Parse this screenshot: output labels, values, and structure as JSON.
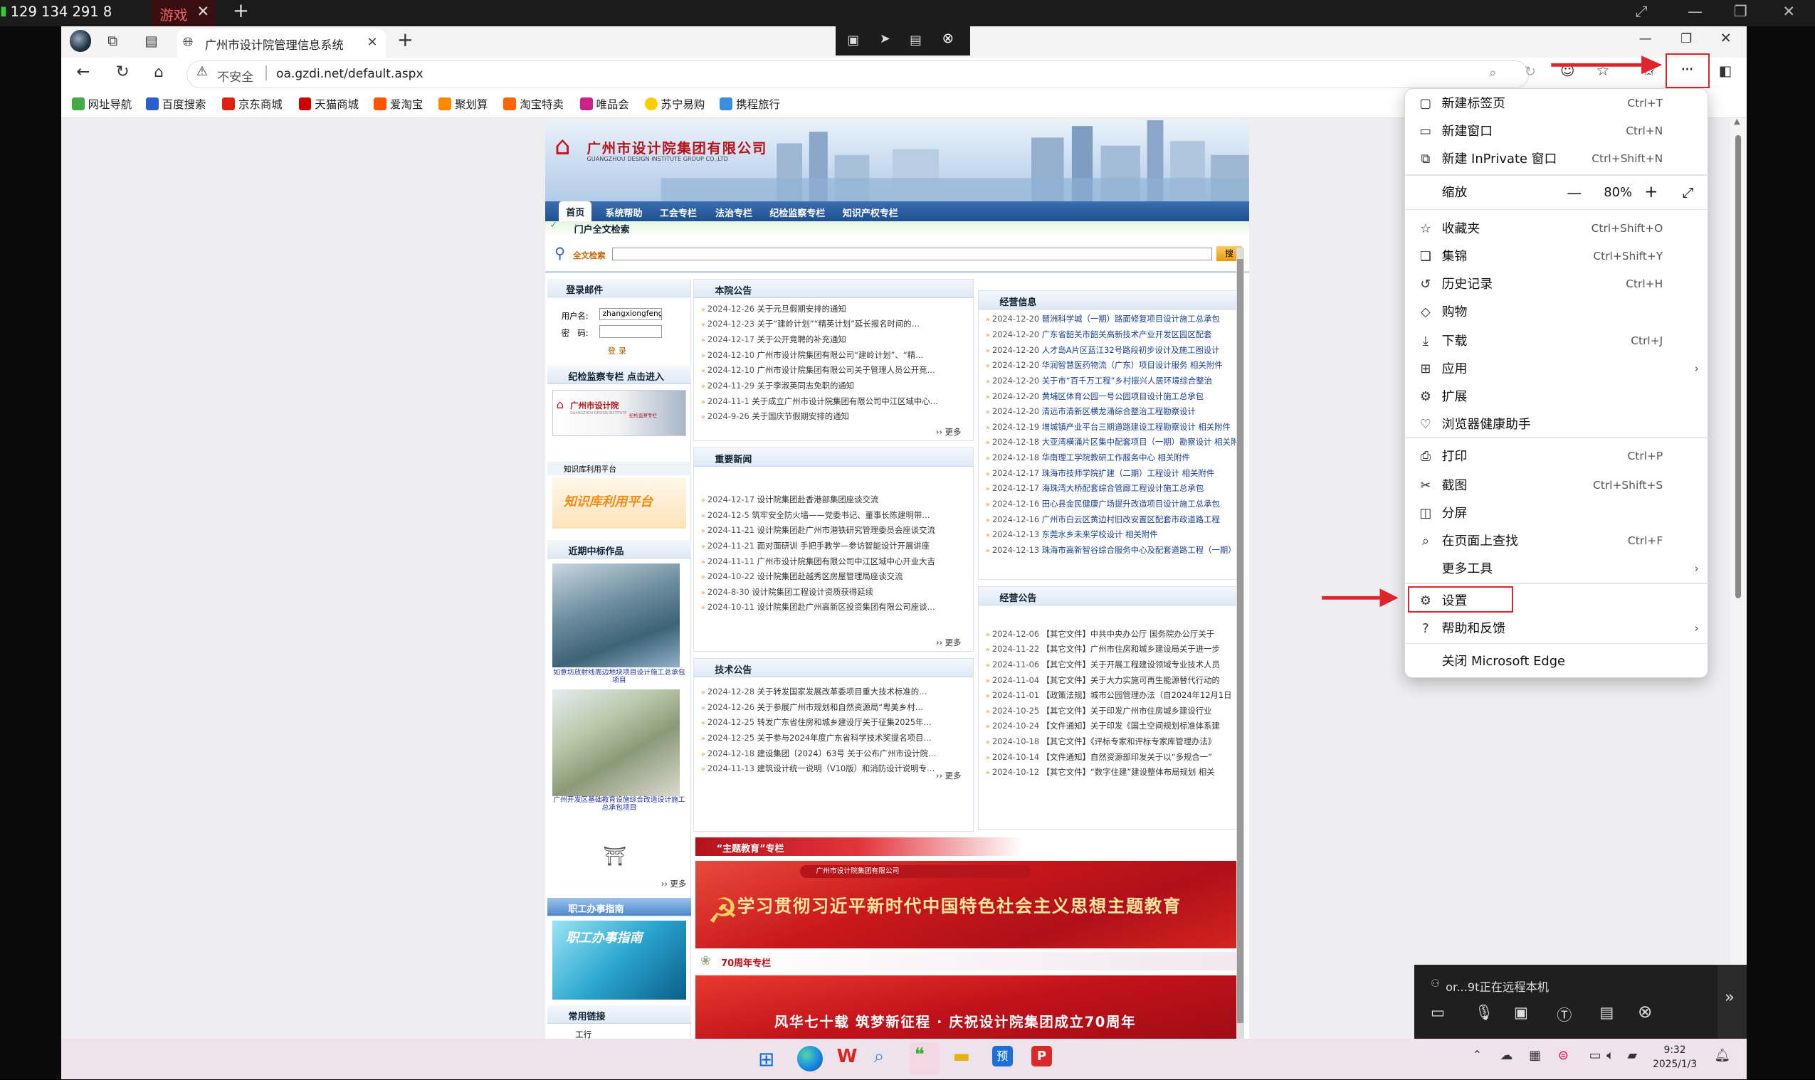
{
  "remote_bar": {
    "id": "129 134 291 8",
    "tab": "游戏"
  },
  "browser": {
    "tab_title": "广州市设计院管理信息系统",
    "insecure": "不安全",
    "url": "oa.gzdi.net/default.aspx",
    "favorites": [
      "网址导航",
      "百度搜索",
      "京东商城",
      "天猫商城",
      "爱淘宝",
      "聚划算",
      "淘宝特卖",
      "唯品会",
      "苏宁易购",
      "携程旅行"
    ]
  },
  "site": {
    "company": "广州市设计院集团有限公司",
    "company_en": "GUANGZHOU DESIGN INSTITUTE GROUP CO.,LTD",
    "nav": [
      "首页",
      "系统帮助",
      "工会专栏",
      "法治专栏",
      "纪检监察专栏",
      "知识产权专栏"
    ],
    "portal": "门户全文检索",
    "search_label": "全文检索",
    "search_btn": "搜",
    "login": {
      "title": "登录邮件",
      "user_label": "用户名:",
      "user_value": "zhangxiongfeng",
      "pwd_label": "密　码:",
      "btn": "登 录"
    },
    "jijian": "纪检监察专栏 点击进入",
    "jijian_banner": "广州市设计院",
    "jijian_banner_en": "GUANGZHOU DESIGN INSTITUTE",
    "jijian_banner_sub": "纪检监察专栏",
    "knowledge": "知识库利用平台",
    "knowledge_banner": "知识库利用平台",
    "bids": "近期中标作品",
    "bid1": "如意坊放射线周边地块项目设计施工总承包项目",
    "bid2": "广州开发区基础教育设施综合改造设计施工总承包项目",
    "staff": "职工办事指南",
    "staff_banner": "职工办事指南",
    "links": "常用链接",
    "links_item": "工行",
    "more": "›› 更多",
    "notice": {
      "title": "本院公告",
      "items": [
        [
          "2024-12-26",
          "关于元旦假期安排的通知"
        ],
        [
          "2024-12-23",
          "关于“建岭计划”“精英计划”延长报名时间的…"
        ],
        [
          "2024-12-17",
          "关于公开竞聘的补充通知"
        ],
        [
          "2024-12-10",
          "广州市设计院集团有限公司“建岭计划”、“精…"
        ],
        [
          "2024-12-10",
          "广州市设计院集团有限公司关于管理人员公开竞…"
        ],
        [
          "2024-11-29",
          "关于李淑英同志免职的通知"
        ],
        [
          "2024-11-1",
          "关于成立广州市设计院集团有限公司中江区域中心…"
        ],
        [
          "2024-9-26",
          "关于国庆节假期安排的通知"
        ]
      ]
    },
    "news": {
      "title": "重要新闻",
      "items": [
        [
          "2024-12-17",
          "设计院集团赴香港部集团座谈交流"
        ],
        [
          "2024-12-5",
          "筑牢安全防火墙——党委书记、董事长陈建明带…"
        ],
        [
          "2024-11-21",
          "设计院集团赴广州市港铁研究管理委员会座谈交流"
        ],
        [
          "2024-11-21",
          "面对面研训 手把手教学—参访智能设计开展讲座"
        ],
        [
          "2024-11-11",
          "广州市设计院集团有限公司中江区域中心开业大吉"
        ],
        [
          "2024-10-22",
          "设计院集团赴越秀区房屋管理局座谈交流"
        ],
        [
          "2024-8-30",
          "设计院集团工程设计资质获得延续"
        ],
        [
          "2024-10-11",
          "设计院集团赴广州高新区投资集团有限公司座谈…"
        ]
      ]
    },
    "tech": {
      "title": "技术公告",
      "items": [
        [
          "2024-12-28",
          "关于转发国家发展改革委项目重大技术标准的…"
        ],
        [
          "2024-12-26",
          "关于参展广州市规划和自然资源局“粤美乡村…"
        ],
        [
          "2024-12-25",
          "转发广东省住房和城乡建设厅关于征集2025年…"
        ],
        [
          "2024-12-25",
          "关于参与2024年度广东省科学技术奖提名项目…"
        ],
        [
          "2024-12-18",
          "建设集团〔2024〕63号 关于公布广州市设计院…"
        ],
        [
          "2024-11-13",
          "建筑设计统一说明（V10版）和消防设计说明专…"
        ]
      ]
    },
    "biz": {
      "title": "经营信息",
      "items": [
        [
          "2024-12-20",
          "琶洲科学城（一期）路面修复项目设计施工总承包"
        ],
        [
          "2024-12-20",
          "广东省韶关市韶关高新技术产业开发区园区配套"
        ],
        [
          "2024-12-20",
          "人才岛A片区蓝江32号路段初步设计及施工图设计"
        ],
        [
          "2024-12-20",
          "华润智慧医药物流（广东）项目设计服务 相关附件"
        ],
        [
          "2024-12-20",
          "关于市“百千万工程”乡村振兴人居环境综合整治"
        ],
        [
          "2024-12-20",
          "黄埔区体育公园一号公园项目设计施工总承包"
        ],
        [
          "2024-12-20",
          "清远市清新区横龙涌综合整治工程勘察设计"
        ],
        [
          "2024-12-19",
          "增城镇产业平台三期道路建设工程勘察设计 相关附件"
        ],
        [
          "2024-12-18",
          "大亚湾横涌片区集中配套项目（一期）勘察设计 相关附件"
        ],
        [
          "2024-12-18",
          "华南理工学院教研工作服务中心 相关附件"
        ],
        [
          "2024-12-17",
          "珠海市技师学院扩建（二期）工程设计 相关附件"
        ],
        [
          "2024-12-17",
          "海珠湾大桥配套综合管廊工程设计施工总承包"
        ],
        [
          "2024-12-16",
          "田心县金民健康广场提升改造项目设计施工总承包"
        ],
        [
          "2024-12-16",
          "广州市白云区黄边村旧改安置区配套市政道路工程"
        ],
        [
          "2024-12-13",
          "东莞水乡未来学校设计 相关附件"
        ],
        [
          "2024-12-13",
          "珠海市高新智谷综合服务中心及配套道路工程（一期）"
        ]
      ]
    },
    "biz2": {
      "title": "经营公告",
      "items": [
        [
          "2024-12-06",
          "【其它文件】中共中央办公厅 国务院办公厅关于"
        ],
        [
          "2024-11-22",
          "【其它文件】广州市住房和城乡建设局关于进一步"
        ],
        [
          "2024-11-06",
          "【其它文件】关于开展工程建设领域专业技术人员"
        ],
        [
          "2024-11-04",
          "【其它文件】关于大力实施可再生能源替代行动的"
        ],
        [
          "2024-11-01",
          "【政策法规】城市公园管理办法（自2024年12月1日"
        ],
        [
          "2024-10-25",
          "【其它文件】关于印发广州市住房城乡建设行业"
        ],
        [
          "2024-10-24",
          "【文件通知】关于印发《国土空间规划标准体系建"
        ],
        [
          "2024-10-18",
          "【其它文件】《评标专家和评标专家库管理办法》"
        ],
        [
          "2024-10-14",
          "【文件通知】自然资源部印发关于以“多规合一”"
        ],
        [
          "2024-10-12",
          "【其它文件】“数字住建”建设整体布局规划 相关"
        ]
      ]
    },
    "theme_title": "“主题教育”专栏",
    "theme_banner_head": "广州市设计院集团有限公司",
    "theme_banner": "学习贯彻习近平新时代中国特色社会主义思想主题教育",
    "anniv_title": "70周年专栏",
    "anniv_banner": "风华七十载 筑梦新征程 · 庆祝设计院集团成立70周年"
  },
  "menu": {
    "items": [
      {
        "label": "新建标签页",
        "shortcut": "Ctrl+T",
        "icon": "new-tab-icon"
      },
      {
        "label": "新建窗口",
        "shortcut": "Ctrl+N",
        "icon": "new-window-icon"
      },
      {
        "label": "新建 InPrivate 窗口",
        "shortcut": "Ctrl+Shift+N",
        "icon": "inprivate-icon"
      },
      {
        "label": "收藏夹",
        "shortcut": "Ctrl+Shift+O",
        "icon": "favorites-icon"
      },
      {
        "label": "集锦",
        "shortcut": "Ctrl+Shift+Y",
        "icon": "collections-icon"
      },
      {
        "label": "历史记录",
        "shortcut": "Ctrl+H",
        "icon": "history-icon"
      },
      {
        "label": "购物",
        "shortcut": "",
        "icon": "shopping-icon"
      },
      {
        "label": "下载",
        "shortcut": "Ctrl+J",
        "icon": "download-icon"
      },
      {
        "label": "应用",
        "shortcut": "",
        "icon": "apps-icon"
      },
      {
        "label": "扩展",
        "shortcut": "",
        "icon": "extensions-icon"
      },
      {
        "label": "浏览器健康助手",
        "shortcut": "",
        "icon": "health-icon"
      },
      {
        "label": "打印",
        "shortcut": "Ctrl+P",
        "icon": "print-icon"
      },
      {
        "label": "截图",
        "shortcut": "Ctrl+Shift+S",
        "icon": "screenshot-icon"
      },
      {
        "label": "分屏",
        "shortcut": "",
        "icon": "split-screen-icon"
      },
      {
        "label": "在页面上查找",
        "shortcut": "Ctrl+F",
        "icon": "find-icon"
      },
      {
        "label": "更多工具",
        "shortcut": "",
        "icon": ""
      },
      {
        "label": "设置",
        "shortcut": "",
        "icon": "settings-icon"
      },
      {
        "label": "帮助和反馈",
        "shortcut": "",
        "icon": "help-icon"
      },
      {
        "label": "关闭 Microsoft Edge",
        "shortcut": "",
        "icon": ""
      }
    ],
    "zoom_label": "缩放",
    "zoom_value": "80%"
  },
  "remote_control": {
    "status": "or...9t正在远程本机"
  },
  "taskbar": {
    "time": "9:32",
    "date": "2025/1/3"
  },
  "colors": {
    "accent": "#e0242c",
    "nav_blue": "#1f4f8f",
    "edge_blue": "#0078d4"
  }
}
